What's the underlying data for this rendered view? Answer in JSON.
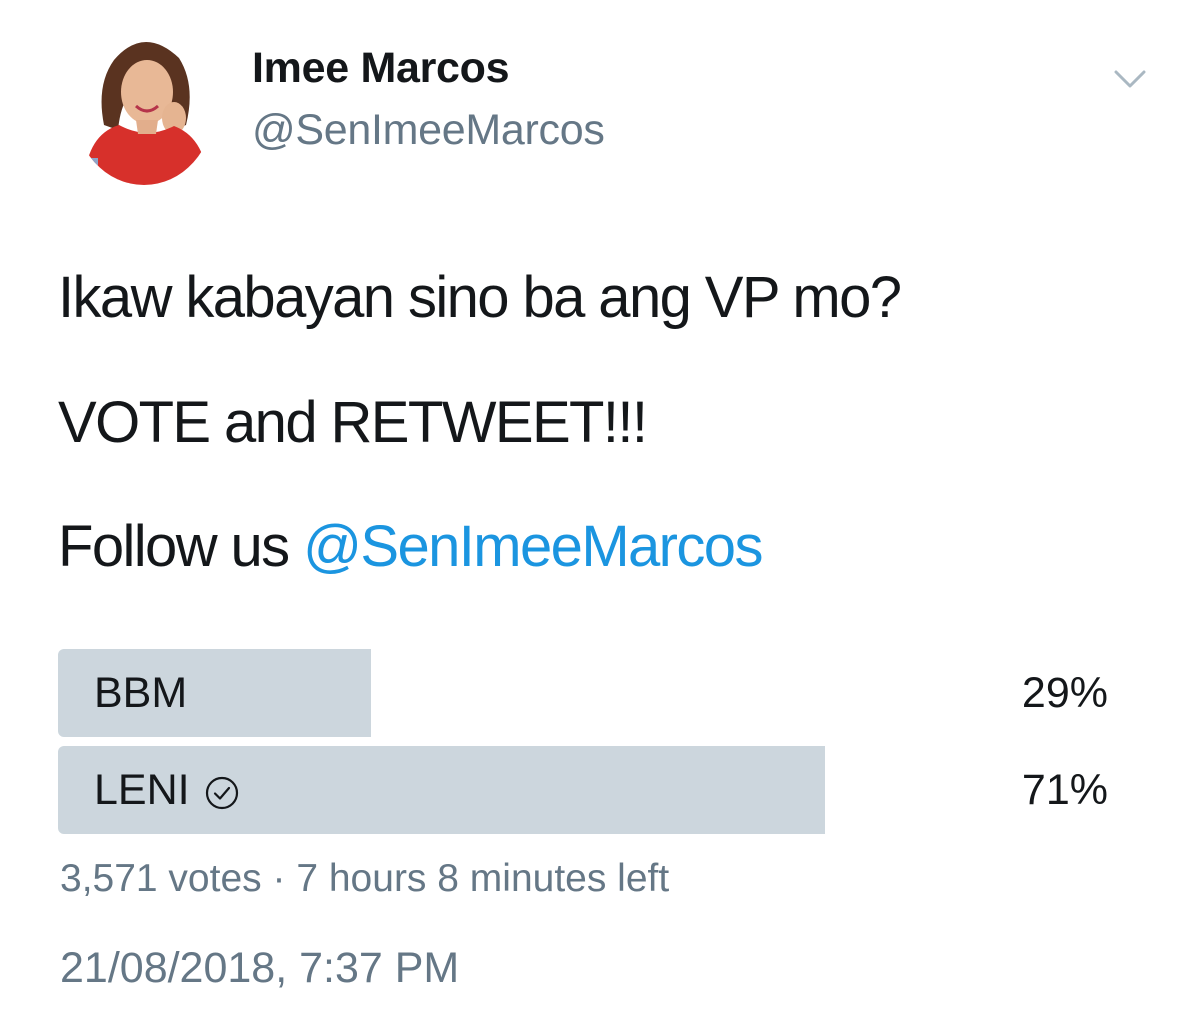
{
  "author": {
    "name": "Imee Marcos",
    "handle": "@SenImeeMarcos"
  },
  "icons": {
    "avatar": "profile-photo",
    "caret": "chevron-down-icon",
    "selected": "check-circle-icon"
  },
  "tweet": {
    "line1": "Ikaw kabayan sino ba ang VP mo?",
    "line2": "VOTE and RETWEET!!!",
    "line3_prefix": "Follow us ",
    "line3_mention": "@SenImeeMarcos"
  },
  "poll": {
    "options": [
      {
        "label": "BBM",
        "percent": "29%",
        "fraction": 0.29,
        "selected": false
      },
      {
        "label": "LENI",
        "percent": "71%",
        "fraction": 0.71,
        "selected": true
      }
    ],
    "votes": "3,571 votes",
    "separator": "·",
    "time_left": "7 hours 8 minutes left"
  },
  "timestamp": "21/08/2018, 7:37 PM",
  "colors": {
    "text": "#14171a",
    "secondary": "#657786",
    "link": "#1b95e0",
    "poll_bar": "#ccd6dd"
  }
}
